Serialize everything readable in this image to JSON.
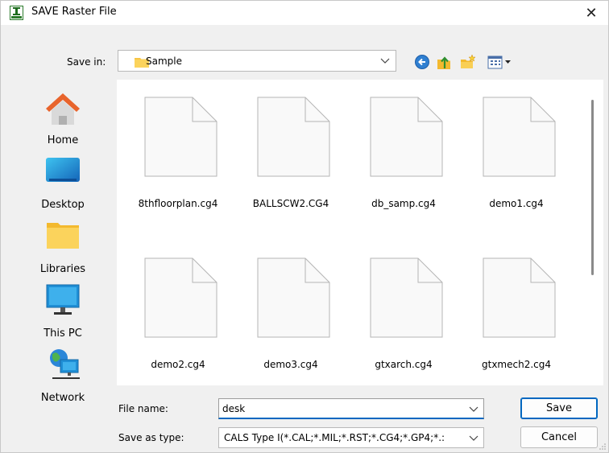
{
  "window": {
    "title": "SAVE Raster File",
    "close_glyph": "✕"
  },
  "save_in": {
    "label": "Save in:",
    "value": "Sample"
  },
  "toolbar": {
    "icons": [
      "back-icon",
      "up-folder-icon",
      "new-folder-icon",
      "view-menu-icon"
    ]
  },
  "places": [
    {
      "label": "Home",
      "icon": "home-icon"
    },
    {
      "label": "Desktop",
      "icon": "desktop-icon"
    },
    {
      "label": "Libraries",
      "icon": "libraries-icon"
    },
    {
      "label": "This PC",
      "icon": "this-pc-icon"
    },
    {
      "label": "Network",
      "icon": "network-icon"
    }
  ],
  "files": [
    {
      "name": "8thfloorplan.cg4"
    },
    {
      "name": "BALLSCW2.CG4"
    },
    {
      "name": "db_samp.cg4"
    },
    {
      "name": "demo1.cg4"
    },
    {
      "name": "demo2.cg4"
    },
    {
      "name": "demo3.cg4"
    },
    {
      "name": "gtxarch.cg4"
    },
    {
      "name": "gtxmech2.cg4"
    }
  ],
  "file_name": {
    "label": "File name:",
    "value": "desk"
  },
  "save_as_type": {
    "label": "Save as type:",
    "value": "CALS Type I(*.CAL;*.MIL;*.RST;*.CG4;*.GP4;*.:"
  },
  "buttons": {
    "save": "Save",
    "cancel": "Cancel"
  },
  "colors": {
    "accent": "#0067c0",
    "folder": "#f7c545",
    "home_roof": "#e8642c",
    "pc_blue": "#1f8fd6"
  }
}
